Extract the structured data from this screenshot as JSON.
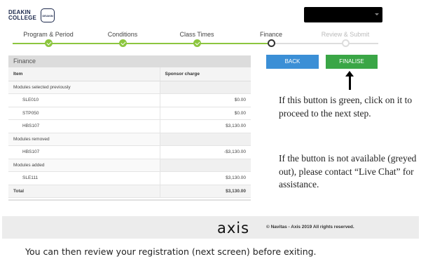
{
  "header": {
    "logo_line1": "DEAKIN",
    "logo_line2": "COLLEGE",
    "badge_text": "DEAKIN",
    "user_menu_redacted": ""
  },
  "steps": [
    {
      "label": "Program & Period",
      "state": "done"
    },
    {
      "label": "Conditions",
      "state": "done"
    },
    {
      "label": "Class Times",
      "state": "done"
    },
    {
      "label": "Finance",
      "state": "current"
    },
    {
      "label": "Review & Submit",
      "state": "future"
    }
  ],
  "finance": {
    "title": "Finance",
    "col_item": "Item",
    "col_charge": "Sponsor charge",
    "rows": [
      {
        "item": "Modules selected previously",
        "charge": "",
        "type": "group"
      },
      {
        "item": "SLE010",
        "charge": "$0.00",
        "type": "line"
      },
      {
        "item": "STP050",
        "charge": "$0.00",
        "type": "line"
      },
      {
        "item": "HBS107",
        "charge": "$3,130.00",
        "type": "line"
      },
      {
        "item": "Modules removed",
        "charge": "",
        "type": "group"
      },
      {
        "item": "HBS107",
        "charge": "-$3,130.00",
        "type": "line"
      },
      {
        "item": "Modules added",
        "charge": "",
        "type": "group"
      },
      {
        "item": "SLE111",
        "charge": "$3,130.00",
        "type": "line"
      },
      {
        "item": "Total",
        "charge": "$3,130.00",
        "type": "total"
      }
    ]
  },
  "buttons": {
    "back": "BACK",
    "finalise": "FINALISE"
  },
  "annotations": {
    "note1": "If this button is green, click on it to proceed to the next step.",
    "note2": "If the button is not available (greyed out), please contact “Live Chat” for assistance."
  },
  "footer": {
    "logo": "axis",
    "copyright": "© Navitas - Axis 2019 All rights reserved."
  },
  "bottom_text": "You can then review your registration (next screen) before exiting.",
  "colors": {
    "step_done": "#8cc63f",
    "back_button": "#3b8fd6",
    "finalise_button": "#3aa646"
  }
}
